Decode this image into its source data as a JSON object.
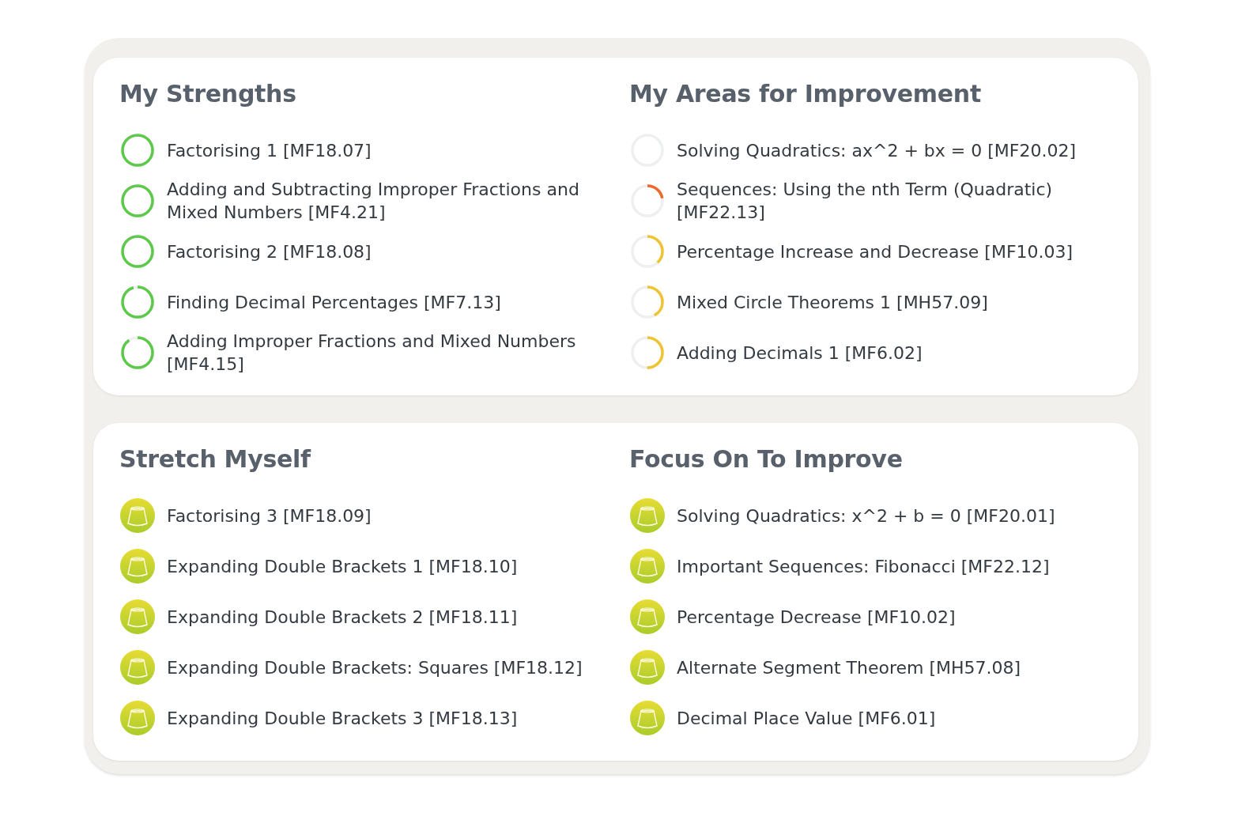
{
  "cards": [
    {
      "sections": [
        {
          "title": "My Strengths",
          "items": [
            {
              "kind": "ring",
              "label": "Factorising 1 [MF18.07]",
              "color": "#5cc94a"
            },
            {
              "kind": "ring",
              "label": "Adding and Subtracting Improper Fractions and Mixed Numbers [MF4.21]",
              "color": "#5cc94a"
            },
            {
              "kind": "ring",
              "label": "Factorising 2 [MF18.08]",
              "color": "#5cc94a"
            },
            {
              "kind": "ring",
              "label": "Finding Decimal Percentages [MF7.13]",
              "color": "#5cc94a"
            },
            {
              "kind": "ring",
              "label": "Adding Improper Fractions and Mixed Numbers [MF4.15]",
              "color": "#5cc94a"
            }
          ]
        },
        {
          "title": "My Areas for Improvement",
          "items": [
            {
              "kind": "ring",
              "label": "Solving Quadratics: ax^2 + bx = 0 [MF20.02]"
            },
            {
              "kind": "ring",
              "label": "Sequences: Using the nth Term (Quadratic) [MF22.13]",
              "color": "#ec6a2c"
            },
            {
              "kind": "ring",
              "label": "Percentage Increase and Decrease [MF10.03]",
              "color": "#f0c330"
            },
            {
              "kind": "ring",
              "label": "Mixed Circle Theorems 1 [MH57.09]",
              "color": "#f0c330"
            },
            {
              "kind": "ring",
              "label": "Adding Decimals 1 [MF6.02]",
              "color": "#f0c330"
            }
          ]
        }
      ]
    },
    {
      "sections": [
        {
          "title": "Stretch Myself",
          "items": [
            {
              "kind": "badge",
              "label": "Factorising 3 [MF18.09]"
            },
            {
              "kind": "badge",
              "label": "Expanding Double Brackets 1 [MF18.10]"
            },
            {
              "kind": "badge",
              "label": "Expanding Double Brackets 2 [MF18.11]"
            },
            {
              "kind": "badge",
              "label": "Expanding Double Brackets: Squares [MF18.12]"
            },
            {
              "kind": "badge",
              "label": "Expanding Double Brackets 3 [MF18.13]"
            }
          ]
        },
        {
          "title": "Focus On To Improve",
          "items": [
            {
              "kind": "badge",
              "label": "Solving Quadratics: x^2 + b = 0 [MF20.01]"
            },
            {
              "kind": "badge",
              "label": "Important Sequences: Fibonacci [MF22.12]"
            },
            {
              "kind": "badge",
              "label": "Percentage Decrease [MF10.02]"
            },
            {
              "kind": "badge",
              "label": "Alternate Segment Theorem [MH57.08]"
            },
            {
              "kind": "badge",
              "label": "Decimal Place Value [MF6.01]"
            }
          ]
        }
      ]
    }
  ]
}
